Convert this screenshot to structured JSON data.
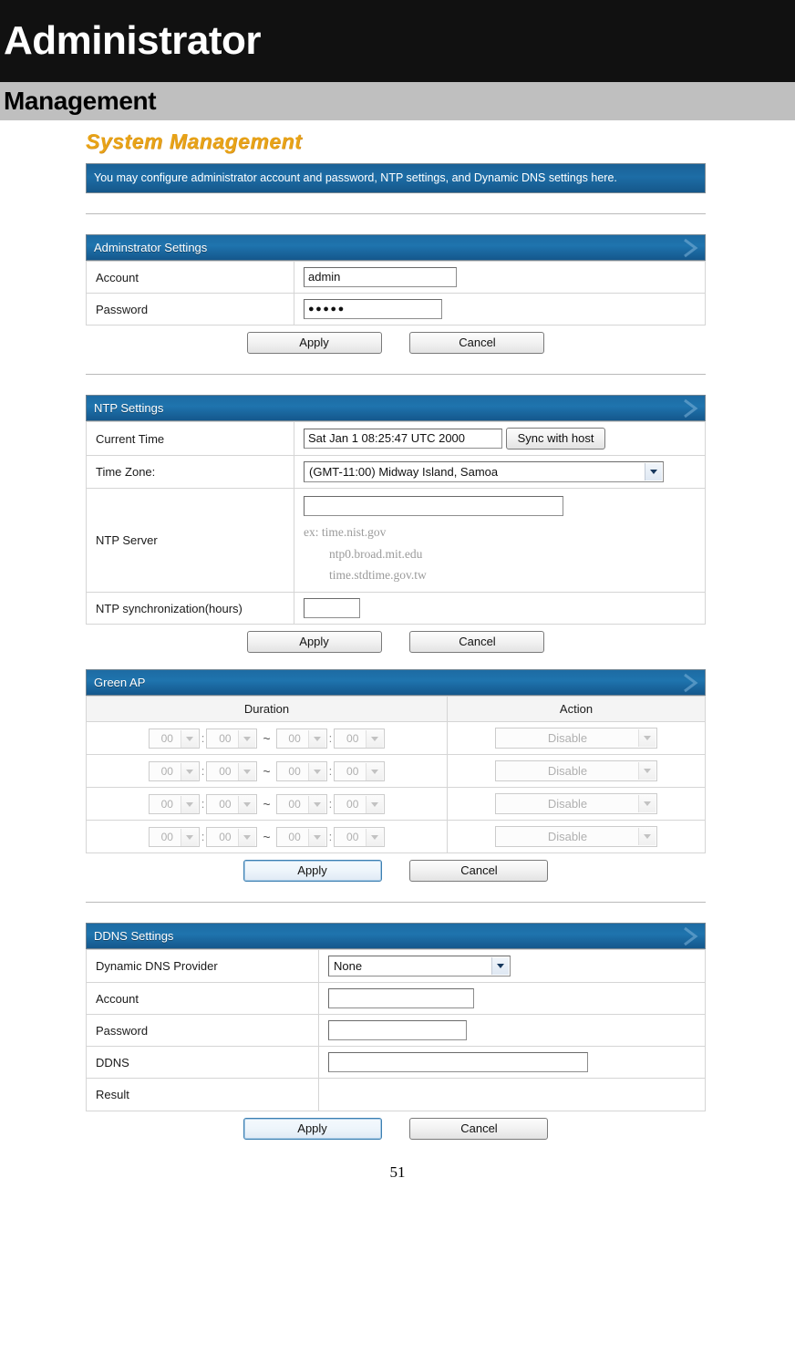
{
  "manual": {
    "chapter_title": "Administrator",
    "section_title": "Management",
    "page_number": "51"
  },
  "webui": {
    "page_heading": "System Management",
    "info_banner": "You may configure administrator account and password, NTP settings, and Dynamic DNS settings here."
  },
  "admin_panel": {
    "header": "Adminstrator Settings",
    "rows": [
      {
        "label": "Account",
        "value": "admin"
      },
      {
        "label": "Password",
        "value": "●●●●●"
      }
    ],
    "apply_label": "Apply",
    "cancel_label": "Cancel"
  },
  "ntp_panel": {
    "header": "NTP Settings",
    "current_time_label": "Current Time",
    "current_time_value": "Sat Jan  1 08:25:47 UTC 2000",
    "sync_button_label": "Sync with host",
    "time_zone_label": "Time Zone:",
    "time_zone_value": "(GMT-11:00) Midway Island, Samoa",
    "ntp_server_label": "NTP Server",
    "ntp_server_value": "",
    "ntp_server_hints": [
      "ex: time.nist.gov",
      "ntp0.broad.mit.edu",
      "time.stdtime.gov.tw"
    ],
    "sync_hours_label": "NTP synchronization(hours)",
    "sync_hours_value": "",
    "apply_label": "Apply",
    "cancel_label": "Cancel"
  },
  "green_ap_panel": {
    "header": "Green AP",
    "col_duration": "Duration",
    "col_action": "Action",
    "rows": [
      {
        "start_hour": "00",
        "start_min": "00",
        "end_hour": "00",
        "end_min": "00",
        "action": "Disable"
      },
      {
        "start_hour": "00",
        "start_min": "00",
        "end_hour": "00",
        "end_min": "00",
        "action": "Disable"
      },
      {
        "start_hour": "00",
        "start_min": "00",
        "end_hour": "00",
        "end_min": "00",
        "action": "Disable"
      },
      {
        "start_hour": "00",
        "start_min": "00",
        "end_hour": "00",
        "end_min": "00",
        "action": "Disable"
      }
    ],
    "time_separator": ":",
    "range_separator": "~",
    "apply_label": "Apply",
    "cancel_label": "Cancel"
  },
  "ddns_panel": {
    "header": "DDNS Settings",
    "rows": [
      {
        "label": "Dynamic DNS Provider",
        "value": "None",
        "type": "select"
      },
      {
        "label": "Account",
        "value": "",
        "type": "input"
      },
      {
        "label": "Password",
        "value": "",
        "type": "input"
      },
      {
        "label": "DDNS",
        "value": "",
        "type": "input"
      },
      {
        "label": "Result",
        "value": "",
        "type": "empty"
      }
    ],
    "apply_label": "Apply",
    "cancel_label": "Cancel"
  },
  "colors": {
    "chapter_bar": "#111111",
    "section_bar": "#bfbfbf",
    "panel_header_blue": "#1d6ba3",
    "heading_orange": "#e8a317",
    "focus_blue": "#3c7fb1"
  }
}
